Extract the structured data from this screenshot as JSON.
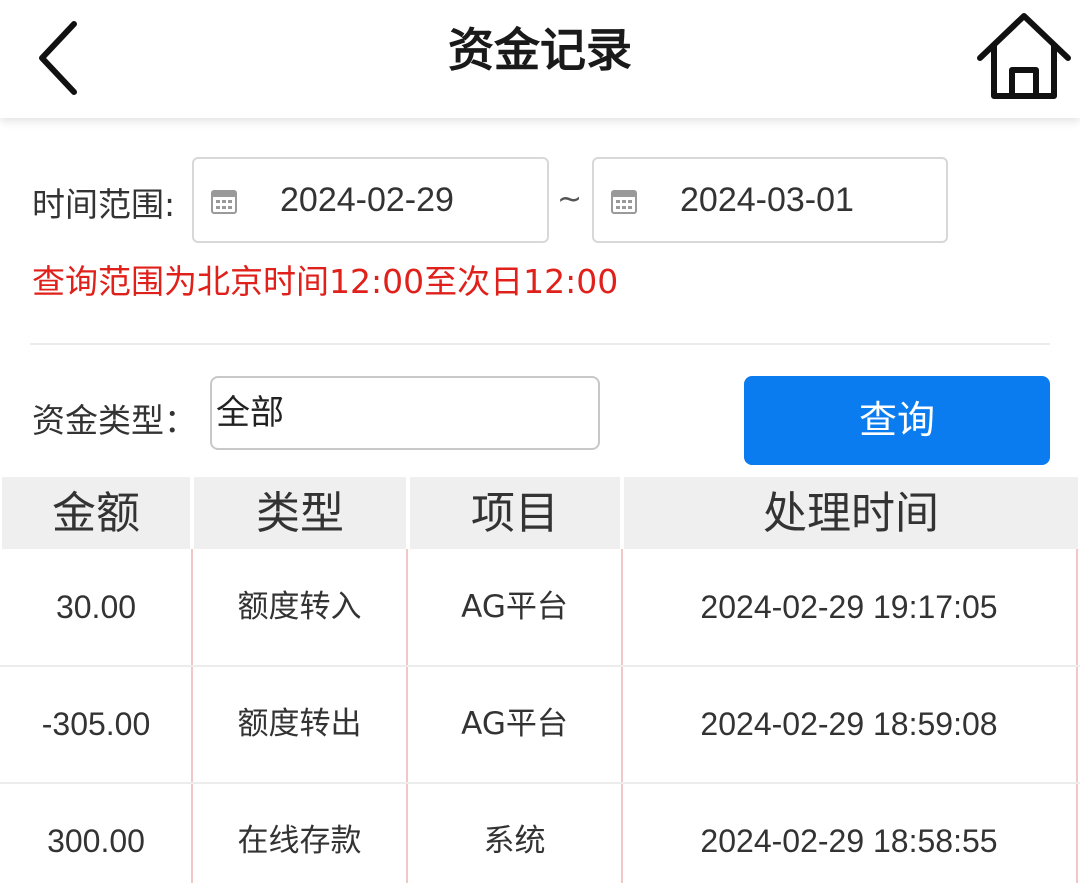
{
  "header": {
    "title": "资金记录",
    "back_icon": "chevron-left-icon",
    "home_icon": "home-icon"
  },
  "filters": {
    "range_label": "时间范围:",
    "start_date": "2024-02-29",
    "end_date": "2024-03-01",
    "separator": "~",
    "calendar_icon": "calendar-icon",
    "notice": "查询范围为北京时间12:00至次日12:00",
    "type_label": "资金类型：",
    "type_value": "全部",
    "query_label": "查询"
  },
  "table": {
    "columns": [
      "金额",
      "类型",
      "项目",
      "处理时间"
    ],
    "rows": [
      [
        "30.00",
        "额度转入",
        "AG平台",
        "2024-02-29 19:17:05"
      ],
      [
        "-305.00",
        "额度转出",
        "AG平台",
        "2024-02-29 18:59:08"
      ],
      [
        "300.00",
        "在线存款",
        "系统",
        "2024-02-29 18:58:55"
      ]
    ]
  },
  "colors": {
    "accent": "#0a7cf0",
    "notice": "#e0201b",
    "header_bg": "#efefef",
    "column_separator": "#f0c8c8"
  }
}
